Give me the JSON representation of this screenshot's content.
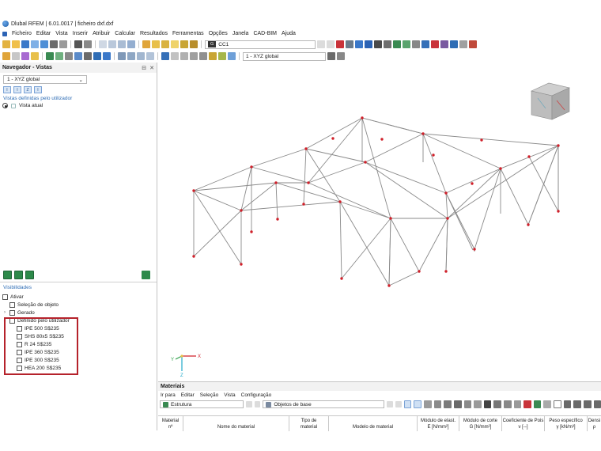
{
  "window": {
    "title": "Dlubal RFEM | 6.01.0017 | ficheiro dxf.dxf"
  },
  "menu": [
    "Ficheiro",
    "Editar",
    "Vista",
    "Inserir",
    "Atribuir",
    "Calcular",
    "Resultados",
    "Ferramentas",
    "Opções",
    "Janela",
    "CAD-BIM",
    "Ajuda"
  ],
  "toolbar": {
    "load_case_tag": "G",
    "load_case": "CC1",
    "view_combo": "1 - XYZ global"
  },
  "navigator": {
    "title": "Navegador - Vistas",
    "view_select": "1 - XYZ global",
    "user_views_title": "Vistas definidas pelo utilizador",
    "current_view": "Vista atual",
    "visibilities_title": "Visibilidades",
    "items": [
      {
        "label": "Ativar",
        "checked": false,
        "level": 0
      },
      {
        "label": "Seleção de objeto",
        "checked": false,
        "level": 1
      },
      {
        "label": "Gerado",
        "checked": false,
        "level": 1,
        "expander": "›"
      },
      {
        "label": "Definido pelo utilizador",
        "checked": false,
        "level": 1,
        "expander": "⌄"
      },
      {
        "label": "IPE 500 S$235",
        "checked": false,
        "level": 2
      },
      {
        "label": "SHS 80x5 S$235",
        "checked": false,
        "level": 2
      },
      {
        "label": "R 24 S$235",
        "checked": false,
        "level": 2
      },
      {
        "label": "IPE 360 S$235",
        "checked": false,
        "level": 2
      },
      {
        "label": "IPE 300 S$235",
        "checked": false,
        "level": 2
      },
      {
        "label": "HEA 200 S$235",
        "checked": false,
        "level": 2
      }
    ]
  },
  "axis": {
    "x_label": "X",
    "y_label": "Y",
    "z_label": "Z"
  },
  "materials": {
    "title": "Materiais",
    "menu": [
      "Ir para",
      "Editar",
      "Seleção",
      "Vista",
      "Configuração"
    ],
    "structure_combo": "Estrutura",
    "objects_combo": "Objetos de base",
    "columns": [
      {
        "line1": "Material",
        "line2": "nº"
      },
      {
        "line1": "",
        "line2": "Nome do material"
      },
      {
        "line1": "Tipo de",
        "line2": "material"
      },
      {
        "line1": "",
        "line2": "Modelo de material"
      },
      {
        "line1": "Módulo de elast.",
        "line2": "E [N/mm²]"
      },
      {
        "line1": "Módulo de corte",
        "line2": "G [N/mm²]"
      },
      {
        "line1": "Coeficiente de Pois",
        "line2": "ν [--]"
      },
      {
        "line1": "Peso específico",
        "line2": "γ [kN/m³]"
      },
      {
        "line1": "Densi",
        "line2": "ρ"
      }
    ]
  },
  "colors": {
    "accent": "#2f6db5",
    "highlight_box": "#b5222b",
    "node": "#d0202a",
    "member": "#8a8a8a"
  }
}
